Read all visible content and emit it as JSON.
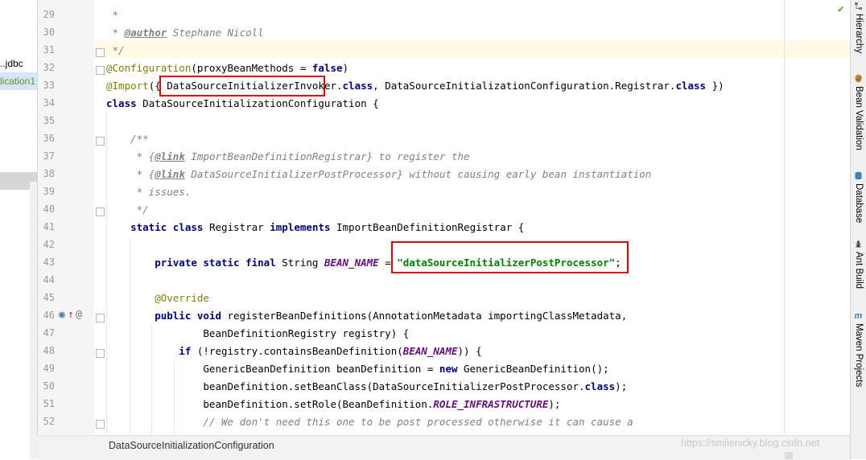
{
  "project_tree": {
    "item1": "..jdbc",
    "item2": "lication1"
  },
  "editor": {
    "lines": [
      {
        "num": "29"
      },
      {
        "num": "30"
      },
      {
        "num": "31"
      },
      {
        "num": "32"
      },
      {
        "num": "33"
      },
      {
        "num": "34"
      },
      {
        "num": "35"
      },
      {
        "num": "36"
      },
      {
        "num": "37"
      },
      {
        "num": "38"
      },
      {
        "num": "39"
      },
      {
        "num": "40"
      },
      {
        "num": "41"
      },
      {
        "num": "42"
      },
      {
        "num": "43"
      },
      {
        "num": "44"
      },
      {
        "num": "45"
      },
      {
        "num": "46"
      },
      {
        "num": "47"
      },
      {
        "num": "48"
      },
      {
        "num": "49"
      },
      {
        "num": "50"
      },
      {
        "num": "51"
      },
      {
        "num": "52"
      }
    ],
    "t": {
      "c29": " *",
      "c30a": " * ",
      "c30b": "@author",
      "c30c": " Stephane Nicoll",
      "c31": " */",
      "c32a": "@Configuration",
      "c32b": "(proxyBeanMethods = ",
      "c32c": "false",
      "c32d": ")",
      "c33a": "@Import",
      "c33b": "({ DataSourceInitializerInvoker.",
      "c33c": "class",
      "c33d": ", DataSourceInitializationConfiguration.Registrar.",
      "c33e": "class",
      "c33f": " })",
      "c34a": "class",
      "c34b": " DataSourceInitializationConfiguration {",
      "c36": "    /**",
      "c37a": "     * {",
      "c37b": "@link",
      "c37c": " ImportBeanDefinitionRegistrar} to register the",
      "c38a": "     * {",
      "c38b": "@link",
      "c38c": " DataSourceInitializerPostProcessor} without causing early bean instantiation",
      "c39": "     * issues.",
      "c40": "     */",
      "c41a": "    static class",
      "c41b": " Registrar ",
      "c41c": "implements",
      "c41d": " ImportBeanDefinitionRegistrar {",
      "c43a": "        private static final",
      "c43b": " String ",
      "c43c": "BEAN_NAME",
      "c43d": " = ",
      "c43e": "\"dataSourceInitializerPostProcessor\"",
      "c43f": ";",
      "c45": "        @Override",
      "c46a": "        public void",
      "c46b": " registerBeanDefinitions(AnnotationMetadata importingClassMetadata,",
      "c47": "                BeanDefinitionRegistry registry) {",
      "c48a": "            if",
      "c48b": " (!registry.containsBeanDefinition(",
      "c48c": "BEAN_NAME",
      "c48d": ")) {",
      "c49a": "                GenericBeanDefinition beanDefinition = ",
      "c49b": "new",
      "c49c": " GenericBeanDefinition();",
      "c50a": "                beanDefinition.setBeanClass(DataSourceInitializerPostProcessor.",
      "c50b": "class",
      "c50c": ");",
      "c51a": "                beanDefinition.setRole(BeanDefinition.",
      "c51b": "ROLE_INFRASTRUCTURE",
      "c51c": ");",
      "c52": "                // We don't need this one to be post processed otherwise it can cause a"
    }
  },
  "status_bar": {
    "breadcrumb": "DataSourceInitializationConfiguration"
  },
  "right_tool_windows": [
    {
      "label": "Hierarchy",
      "icon": "hierarchy-icon"
    },
    {
      "label": "Bean Validation",
      "icon": "bean-validation-icon"
    },
    {
      "label": "Database",
      "icon": "database-icon"
    },
    {
      "label": "Ant Build",
      "icon": "ant-icon"
    },
    {
      "label": "Maven Projects",
      "icon": "maven-icon"
    }
  ],
  "watermark": "https://smilenicky.blog.csdn.net",
  "colors": {
    "keyword": "#000080",
    "comment": "#808080",
    "annotation": "#808000",
    "string": "#008000",
    "constant": "#660e7a",
    "highlight_box": "#e60000"
  }
}
